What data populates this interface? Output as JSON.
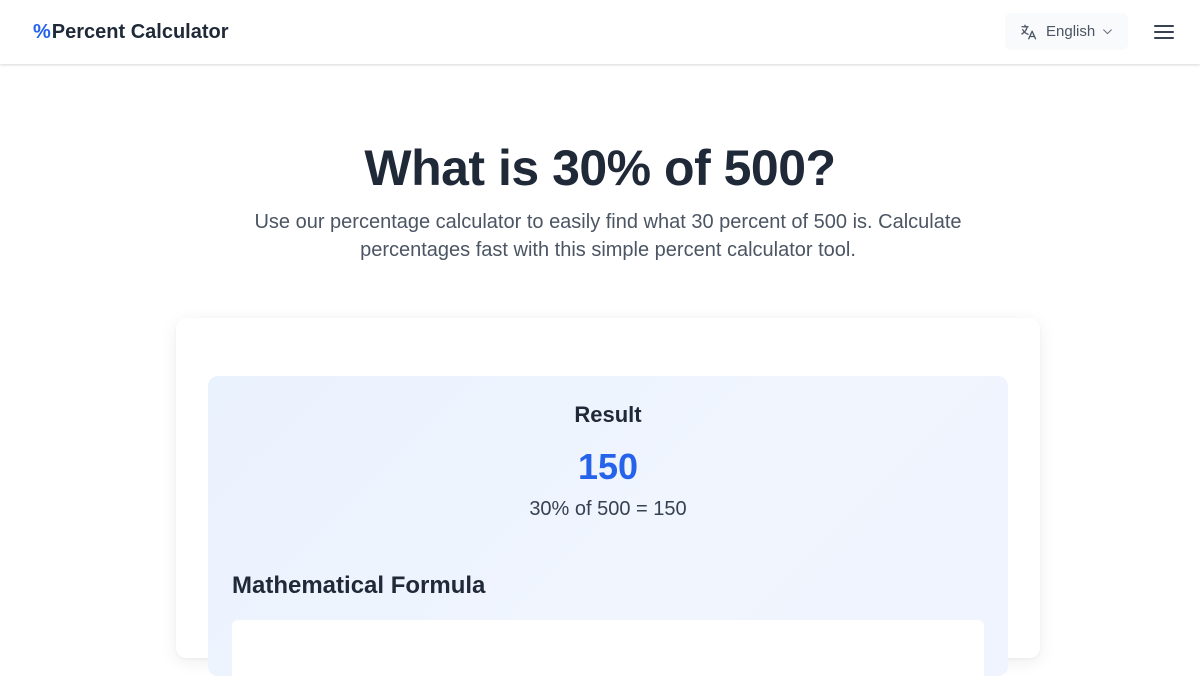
{
  "header": {
    "logo_symbol": "%",
    "logo_text": "Percent Calculator",
    "language": {
      "icon": "translate-icon",
      "label": "English",
      "chevron_icon": "chevron-down-icon"
    },
    "menu_icon": "hamburger-menu-icon"
  },
  "hero": {
    "title": "What is 30% of 500?",
    "subtitle": "Use our percentage calculator to easily find what 30 percent of 500 is. Calculate percentages fast with this simple percent calculator tool."
  },
  "result": {
    "label": "Result",
    "value": "150",
    "equation": "30% of 500 = 150"
  },
  "formula": {
    "title": "Mathematical Formula"
  },
  "colors": {
    "accent": "#2563eb",
    "text_dark": "#1f2937",
    "text_muted": "#4b5563",
    "panel_bg": "#eef4fe"
  }
}
